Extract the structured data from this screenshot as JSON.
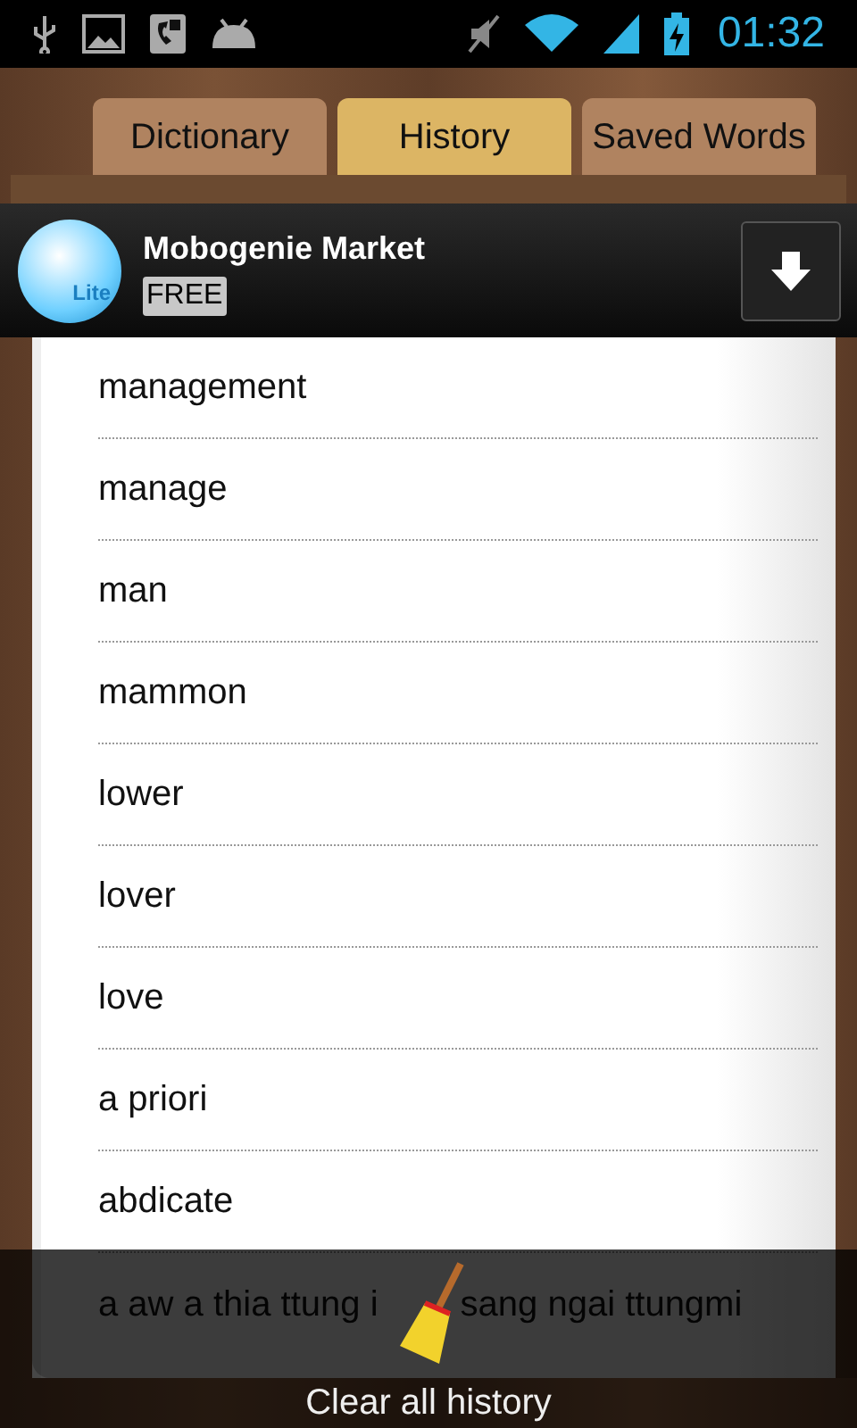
{
  "status_bar": {
    "time": "01:32"
  },
  "tabs": [
    {
      "label": "Dictionary",
      "selected": false
    },
    {
      "label": "History",
      "selected": true
    },
    {
      "label": "Saved Words",
      "selected": false
    }
  ],
  "ad_banner": {
    "title": "Mobogenie Market",
    "badge": "FREE",
    "logo_text": "Lite"
  },
  "history": [
    "management",
    "manage",
    "man",
    "mammon",
    "lower",
    "lover",
    "love",
    "a priori",
    "abdicate"
  ],
  "covered_item": {
    "before": "a aw a thia ttung i",
    "after": "sang ngai ttungmi"
  },
  "clear_button": {
    "label": "Clear all history"
  }
}
